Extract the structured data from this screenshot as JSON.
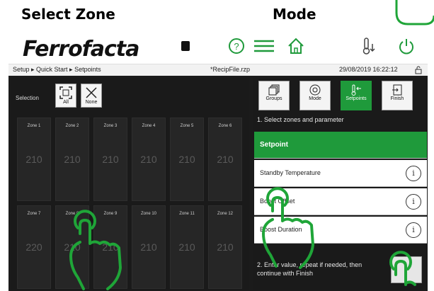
{
  "captions": {
    "left": "Select Zone",
    "right": "Mode"
  },
  "topbar": {
    "logo": "Ferrofacta",
    "icons": [
      "help-icon",
      "menu-icon",
      "home-icon",
      "thermometer-down-icon",
      "power-icon"
    ]
  },
  "crumbbar": {
    "breadcrumb": "Setup ▸ Quick Start ▸ Setpoints",
    "file": "*RecipFile.rzp",
    "datetime": "29/08/2019 16:22:12"
  },
  "selection": {
    "label": "Selection",
    "all": "All",
    "none": "None"
  },
  "zones": [
    {
      "name": "Zone 1",
      "value": "210"
    },
    {
      "name": "Zone 2",
      "value": "210"
    },
    {
      "name": "Zone 3",
      "value": "210"
    },
    {
      "name": "Zone 4",
      "value": "210"
    },
    {
      "name": "Zone 5",
      "value": "210"
    },
    {
      "name": "Zone 6",
      "value": "210"
    },
    {
      "name": "Zone 7",
      "value": "220"
    },
    {
      "name": "Zone 8",
      "value": "210"
    },
    {
      "name": "Zone 9",
      "value": "210"
    },
    {
      "name": "Zone 10",
      "value": "210"
    },
    {
      "name": "Zone 11",
      "value": "210"
    },
    {
      "name": "Zone 12",
      "value": "210"
    }
  ],
  "tabs": [
    {
      "label": "Groups",
      "icon": "groups-icon"
    },
    {
      "label": "Mode",
      "icon": "mode-icon"
    },
    {
      "label": "Setpoints",
      "icon": "setpoints-icon"
    },
    {
      "label": "Finish",
      "icon": "finish-icon"
    }
  ],
  "step1": "1. Select zones and parameter",
  "params": {
    "header": "Setpoint",
    "rows": [
      "Standby Temperature",
      "Boost Offset",
      "Boost Duration"
    ]
  },
  "step2": "2. Enter value, repeat if needed, then continue with Finish",
  "colors": {
    "accent": "#1f9a3b",
    "panel": "#1a1a1a"
  }
}
